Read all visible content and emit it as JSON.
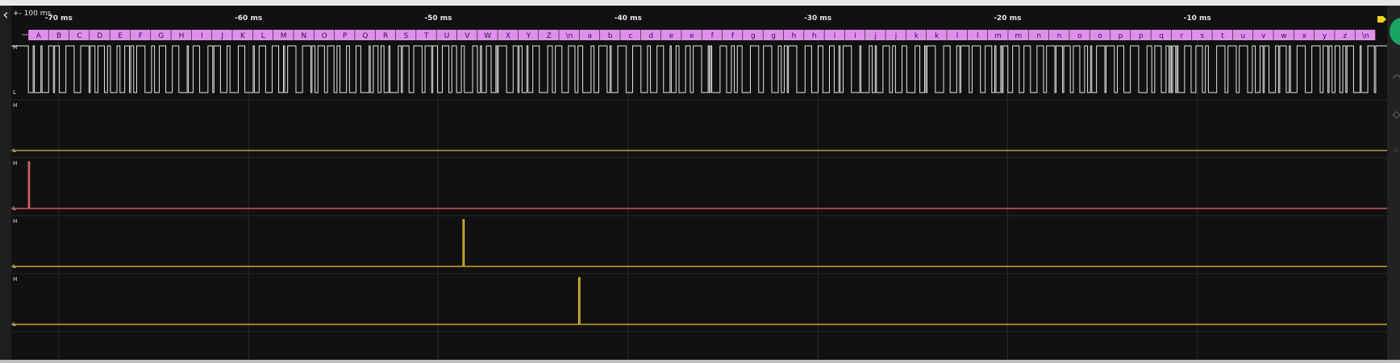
{
  "toolbar": {
    "back_icon": "chevron-left-icon",
    "zoom_label": "+- 100 ms"
  },
  "timeline": {
    "unit": "ms",
    "range_ms": [
      -72.5,
      0
    ],
    "tick_values": [
      -70,
      -60,
      -50,
      -40,
      -30,
      -20,
      -10
    ],
    "tick_labels": [
      "-70 ms",
      "-60 ms",
      "-50 ms",
      "-40 ms",
      "-30 ms",
      "-20 ms",
      "-10 ms"
    ],
    "end_marker_color": "#f2d21b"
  },
  "decoder": {
    "color": "#df90ec",
    "label_color": "#3a0d44",
    "frame_start_ms": -71.6,
    "frame_end_ms": -0.6,
    "bytes": [
      "A",
      "B",
      "C",
      "D",
      "E",
      "F",
      "G",
      "H",
      "I",
      "J",
      "K",
      "L",
      "M",
      "N",
      "O",
      "P",
      "Q",
      "R",
      "S",
      "T",
      "U",
      "V",
      "W",
      "X",
      "Y",
      "Z",
      "\\n",
      "a",
      "b",
      "c",
      "d",
      "e",
      "e",
      "f",
      "f",
      "g",
      "g",
      "h",
      "h",
      "i",
      "i",
      "j",
      "j",
      "k",
      "k",
      "l",
      "l",
      "m",
      "m",
      "n",
      "n",
      "o",
      "o",
      "p",
      "p",
      "q",
      "r",
      "s",
      "t",
      "u",
      "v",
      "w",
      "x",
      "y",
      "z",
      "\\n"
    ]
  },
  "channels": [
    {
      "high_label": "H",
      "low_label": "L",
      "color": "#e6e6e6",
      "kind": "serial",
      "idle_level": "high",
      "activity_start_ms": -71.6,
      "activity_end_ms": -0.6
    },
    {
      "high_label": "H",
      "low_label": "L",
      "color": "#d8b452",
      "kind": "flat",
      "level": "low"
    },
    {
      "high_label": "H",
      "low_label": "L",
      "color": "#f06a6a",
      "kind": "pulse",
      "pulse_ms": -71.6
    },
    {
      "high_label": "H",
      "low_label": "L",
      "color": "#f0c330",
      "kind": "pulse",
      "pulse_ms": -48.7
    },
    {
      "high_label": "H",
      "low_label": "L",
      "color": "#f0c330",
      "kind": "pulse",
      "pulse_ms": -42.6
    }
  ]
}
